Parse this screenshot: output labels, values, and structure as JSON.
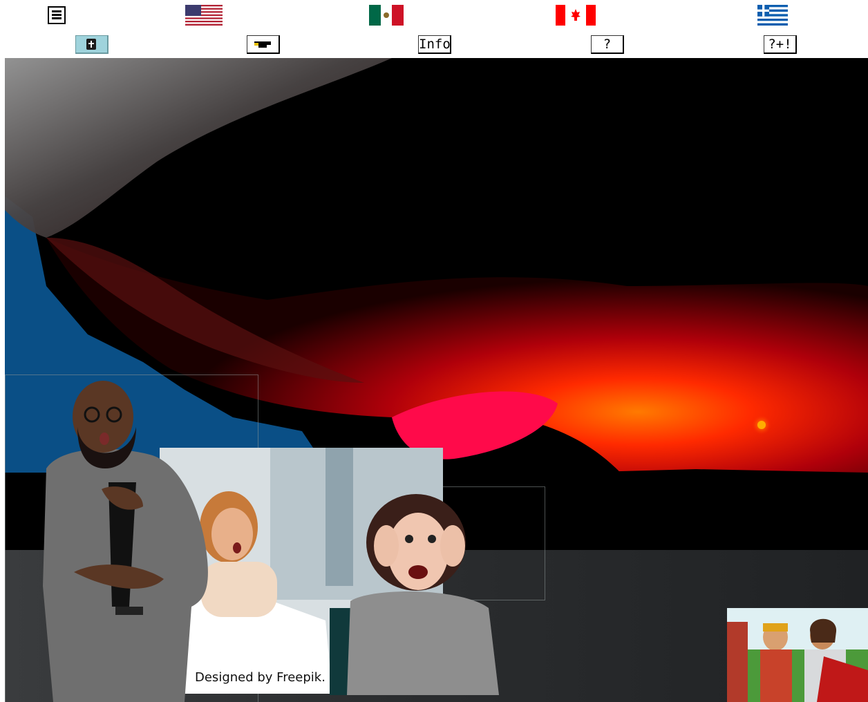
{
  "topbar": {
    "menu_icon": "hamburger-menu-icon",
    "flags": [
      {
        "name": "usa-flag",
        "colors": [
          "#b22234",
          "#ffffff",
          "#3c3b6e"
        ]
      },
      {
        "name": "mexico-flag",
        "colors": [
          "#006847",
          "#ffffff",
          "#ce1126"
        ]
      },
      {
        "name": "canada-flag",
        "colors": [
          "#ff0000",
          "#ffffff"
        ]
      },
      {
        "name": "greece-flag",
        "colors": [
          "#0d5eaf",
          "#ffffff"
        ]
      }
    ]
  },
  "nav": {
    "bible_icon": "bible-cross-icon",
    "graduation_icon": "graduation-cap-icon",
    "info_label": "Info",
    "help_label": "?",
    "more_help_label": "?+!"
  },
  "hero": {
    "scene": "red-storm-cloud-sunset",
    "accent_colors": [
      "#e8002a",
      "#ff5a00",
      "#0a4f86",
      "#000000"
    ],
    "credit_text": "Designed by Freepik."
  }
}
